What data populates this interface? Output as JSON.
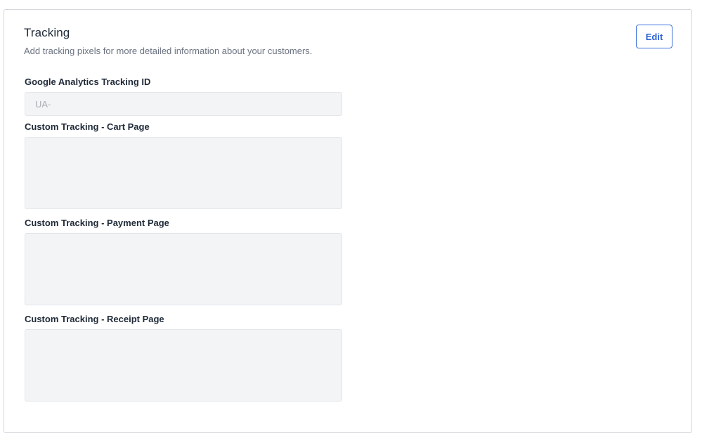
{
  "section": {
    "title": "Tracking",
    "subtitle": "Add tracking pixels for more detailed information about your customers.",
    "edit_label": "Edit"
  },
  "fields": {
    "ga": {
      "label": "Google Analytics Tracking ID",
      "placeholder": "UA-",
      "value": ""
    },
    "cart": {
      "label": "Custom Tracking - Cart Page",
      "value": ""
    },
    "payment": {
      "label": "Custom Tracking - Payment Page",
      "value": ""
    },
    "receipt": {
      "label": "Custom Tracking - Receipt Page",
      "value": ""
    }
  },
  "colors": {
    "accent": "#2f63d1",
    "field_bg": "#f3f4f6",
    "border": "#d4d6da"
  }
}
